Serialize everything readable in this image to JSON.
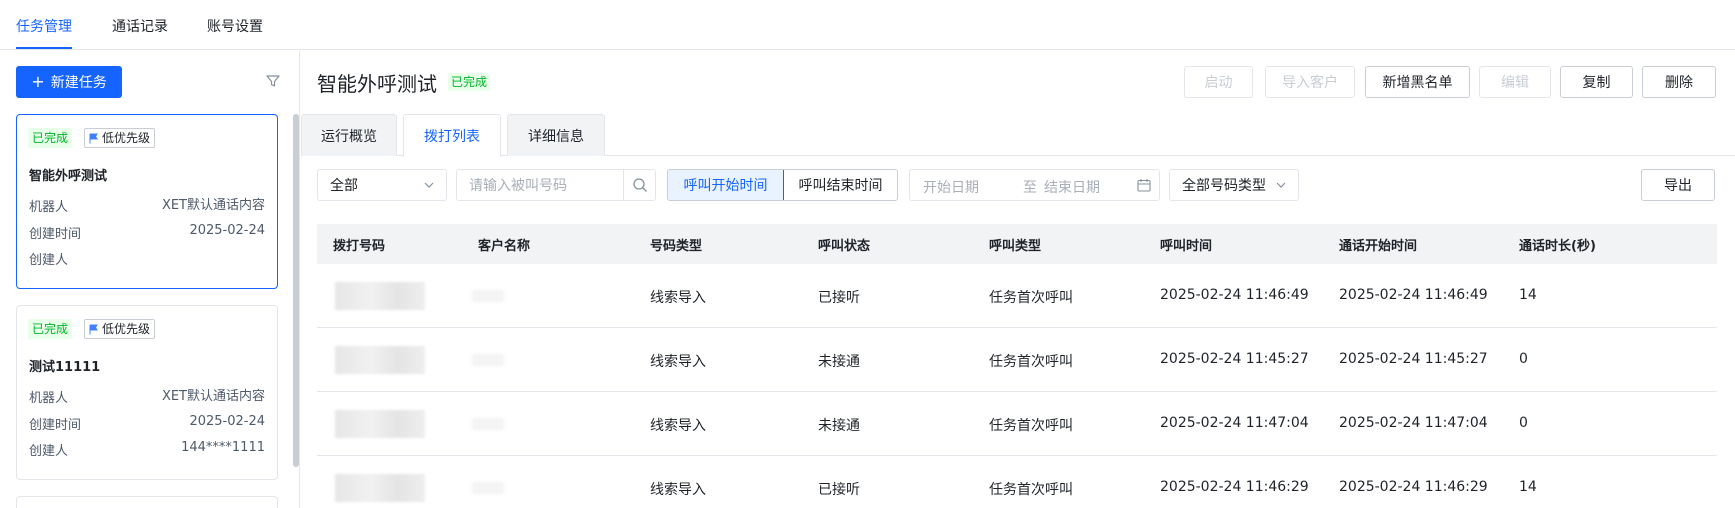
{
  "nav": {
    "tabs": [
      "任务管理",
      "通话记录",
      "账号设置"
    ]
  },
  "left": {
    "new_task_label": "新建任务",
    "cards": [
      {
        "status": "已完成",
        "priority": "低优先级",
        "title": "智能外呼测试",
        "robot_key": "机器人",
        "robot_val": "XET默认通话内容",
        "created_key": "创建时间",
        "created_val": "2025-02-24",
        "creator_key": "创建人",
        "creator_val": ""
      },
      {
        "status": "已完成",
        "priority": "低优先级",
        "title": "测试11111",
        "robot_key": "机器人",
        "robot_val": "XET默认通话内容",
        "created_key": "创建时间",
        "created_val": "2025-02-24",
        "creator_key": "创建人",
        "creator_val": "144****1111"
      }
    ]
  },
  "main": {
    "title": "智能外呼测试",
    "status": "已完成",
    "actions": {
      "start": "启动",
      "import": "导入客户",
      "blacklist": "新增黑名单",
      "edit": "编辑",
      "copy": "复制",
      "delete": "删除"
    },
    "tabs": [
      "运行概览",
      "拨打列表",
      "详细信息"
    ],
    "filters": {
      "status_select": "全部",
      "search_placeholder": "请输入被叫号码",
      "time_seg": [
        "呼叫开始时间",
        "呼叫结束时间"
      ],
      "start_placeholder": "开始日期",
      "date_sep": "至",
      "end_placeholder": "结束日期",
      "number_type_select": "全部号码类型",
      "export": "导出"
    },
    "table": {
      "headers": [
        "拨打号码",
        "客户名称",
        "号码类型",
        "呼叫状态",
        "呼叫类型",
        "呼叫时间",
        "通话开始时间",
        "通话时长(秒)"
      ],
      "rows": [
        [
          "线索导入",
          "已接听",
          "任务首次呼叫",
          "2025-02-24 11:46:49",
          "2025-02-24 11:46:49",
          "14"
        ],
        [
          "线索导入",
          "未接通",
          "任务首次呼叫",
          "2025-02-24 11:45:27",
          "2025-02-24 11:45:27",
          "0"
        ],
        [
          "线索导入",
          "未接通",
          "任务首次呼叫",
          "2025-02-24 11:47:04",
          "2025-02-24 11:47:04",
          "0"
        ],
        [
          "线索导入",
          "已接听",
          "任务首次呼叫",
          "2025-02-24 11:46:29",
          "2025-02-24 11:46:29",
          "14"
        ]
      ]
    }
  },
  "colors": {
    "primary": "#1664ff",
    "success": "#00b42a",
    "success_bg": "#e8ffea",
    "border": "#e5e6eb"
  }
}
